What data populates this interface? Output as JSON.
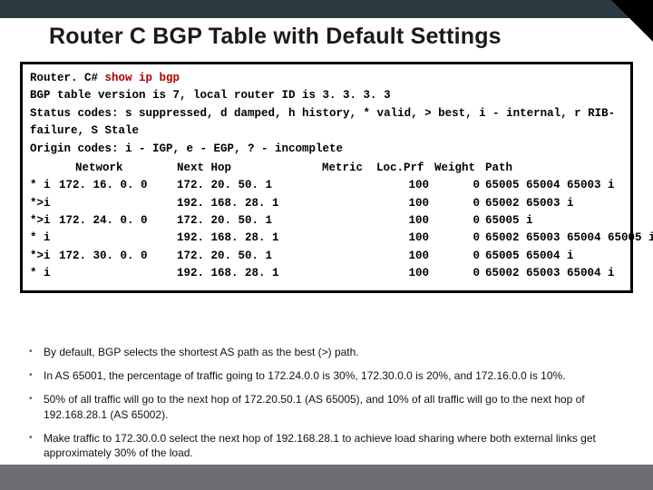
{
  "title": "Router C BGP Table with Default Settings",
  "terminal": {
    "prompt": "Router. C# ",
    "command": "show ip bgp",
    "line_version": "BGP table version is 7, local router ID is 3. 3. 3. 3",
    "line_status_codes": "Status codes: s suppressed, d damped, h history, * valid, > best, i - internal, r RIB-failure, S Stale",
    "line_origin_codes": "Origin codes: i - IGP, e - EGP, ? - incomplete",
    "headers": {
      "network": "Network",
      "nexthop": "Next Hop",
      "metric": "Metric",
      "locprf": "Loc.Prf",
      "weight": "Weight",
      "path": "Path"
    },
    "rows": [
      {
        "status": "* i",
        "network": "172. 16. 0. 0",
        "nexthop": "172. 20. 50. 1",
        "metric": "",
        "locprf": "100",
        "weight": "0",
        "path": "65005 65004 65003 i"
      },
      {
        "status": "*>i",
        "network": "",
        "nexthop": "192. 168. 28. 1",
        "metric": "",
        "locprf": "100",
        "weight": "0",
        "path": "65002 65003 i"
      },
      {
        "status": "*>i",
        "network": "172. 24. 0. 0",
        "nexthop": "172. 20. 50. 1",
        "metric": "",
        "locprf": "100",
        "weight": "0",
        "path": "65005 i"
      },
      {
        "status": "* i",
        "network": "",
        "nexthop": "192. 168. 28. 1",
        "metric": "",
        "locprf": "100",
        "weight": "0",
        "path": "65002 65003 65004 65005 i"
      },
      {
        "status": "*>i",
        "network": "172. 30. 0. 0",
        "nexthop": "172. 20. 50. 1",
        "metric": "",
        "locprf": "100",
        "weight": "0",
        "path": "65005 65004 i"
      },
      {
        "status": "* i",
        "network": "",
        "nexthop": "192. 168. 28. 1",
        "metric": "",
        "locprf": "100",
        "weight": "0",
        "path": "65002 65003 65004 i"
      }
    ]
  },
  "bullets": [
    "By default, BGP selects the shortest AS path as the best (>) path.",
    "In AS 65001, the percentage of traffic going to 172.24.0.0 is 30%, 172.30.0.0 is 20%, and 172.16.0.0 is 10%.",
    "50% of all traffic will go to the next hop of 172.20.50.1 (AS 65005), and 10% of all traffic will go to the next hop of 192.168.28.1 (AS 65002).",
    "Make traffic to 172.30.0.0 select the next hop of 192.168.28.1 to achieve load sharing where both external links get approximately 30% of the load."
  ]
}
